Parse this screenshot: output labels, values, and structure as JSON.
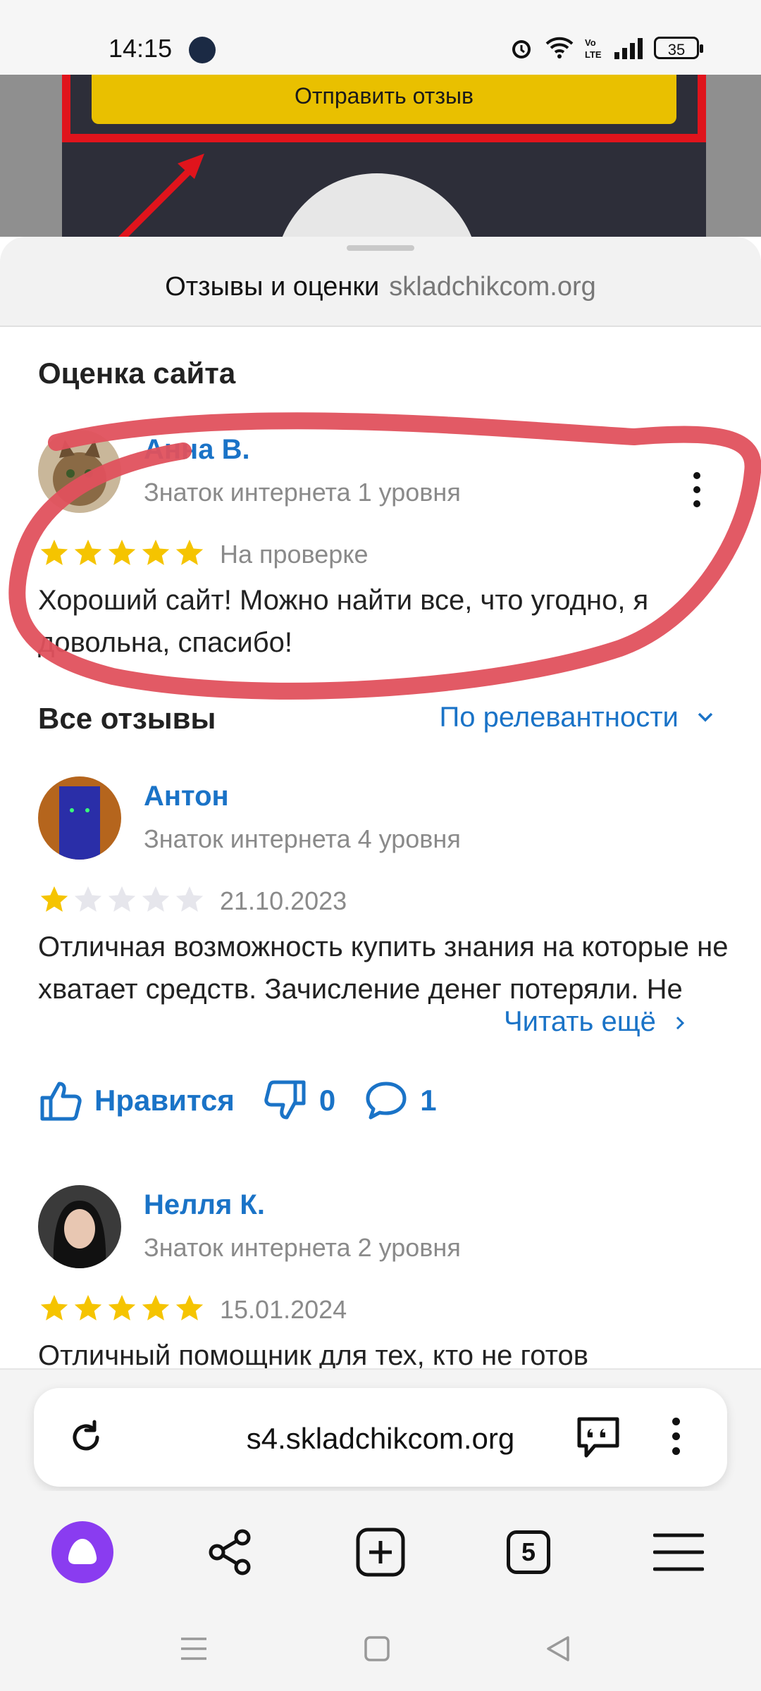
{
  "status_bar": {
    "time": "14:15",
    "battery": "35"
  },
  "background_page": {
    "button_label": "Отправить отзыв"
  },
  "sheet": {
    "title": "Отзывы и оценки",
    "domain": "skladchikcom.org"
  },
  "site_rating": {
    "heading": "Оценка сайта",
    "my_review": {
      "author": "Анна В.",
      "level": "Знаток интернета 1 уровня",
      "rating": 5,
      "status": "На проверке",
      "text": "Хороший сайт! Можно найти все, что угодно, я довольна, спасибо!"
    }
  },
  "all_reviews": {
    "heading": "Все отзывы",
    "sort_label": "По релевантности",
    "items": [
      {
        "author": "Антон",
        "level": "Знаток интернета 4 уровня",
        "rating": 1,
        "date": "21.10.2023",
        "text": "Отличная возможность купить знания на которые не хватает средств. Зачисление денег потеряли. Не",
        "read_more": "Читать ещё",
        "like_label": "Нравится",
        "dislikes": "0",
        "comments": "1"
      },
      {
        "author": "Нелля К.",
        "level": "Знаток интернета 2 уровня",
        "rating": 5,
        "date": "15.01.2024",
        "text": "Отличный помощник для тех, кто не готов"
      }
    ]
  },
  "browser": {
    "url": "s4.skladchikcom.org",
    "tab_count": "5"
  },
  "colors": {
    "link": "#1a73c7",
    "star": "#f5c400",
    "annotation": "#e0515d",
    "alice": "#8a3cf0"
  }
}
